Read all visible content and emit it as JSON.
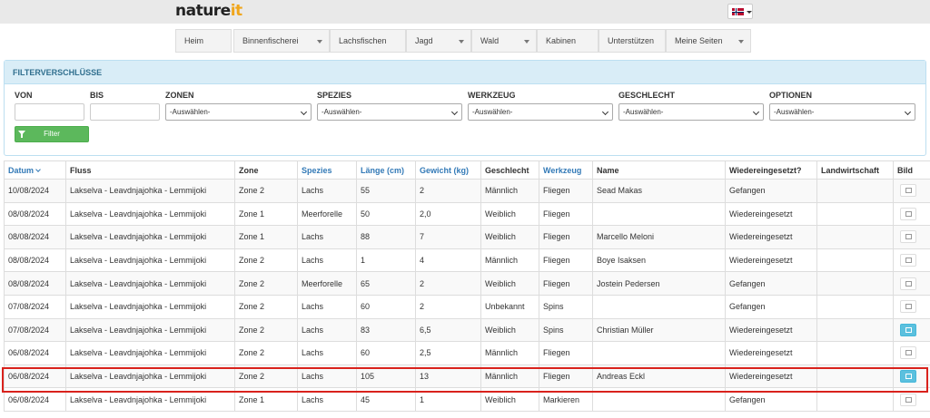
{
  "header": {
    "logo_part1": "nature",
    "logo_part2": "it"
  },
  "nav": [
    {
      "label": "Heim",
      "dropdown": false
    },
    {
      "label": "Binnenfischerei",
      "dropdown": true
    },
    {
      "label": "Lachsfischen",
      "dropdown": false
    },
    {
      "label": "Jagd",
      "dropdown": true
    },
    {
      "label": "Wald",
      "dropdown": true
    },
    {
      "label": "Kabinen",
      "dropdown": false
    },
    {
      "label": "Unterstützen",
      "dropdown": false
    },
    {
      "label": "Meine Seiten",
      "dropdown": true
    }
  ],
  "filter": {
    "title": "FILTERVERSCHLÜSSE",
    "labels": {
      "von": "VON",
      "bis": "BIS",
      "zonen": "ZONEN",
      "spezies": "SPEZIES",
      "werkzeug": "WERKZEUG",
      "geschlecht": "GESCHLECHT",
      "optionen": "OPTIONEN"
    },
    "select_placeholder": "-Auswählen-",
    "button_label": "Filter"
  },
  "table": {
    "headers": [
      "Datum",
      "Fluss",
      "Zone",
      "Spezies",
      "Länge (cm)",
      "Gewicht (kg)",
      "Geschlecht",
      "Werkzeug",
      "Name",
      "Wiedereingesetzt?",
      "Landwirtschaft",
      "Bild"
    ],
    "rows": [
      [
        "10/08/2024",
        "Lakselva - Leavdnjajohka - Lemmijoki",
        "Zone 2",
        "Lachs",
        "55",
        "2",
        "Männlich",
        "Fliegen",
        "Sead Makas",
        "Gefangen",
        "",
        ""
      ],
      [
        "08/08/2024",
        "Lakselva - Leavdnjajohka - Lemmijoki",
        "Zone 1",
        "Meerforelle",
        "50",
        "2,0",
        "Weiblich",
        "Fliegen",
        "",
        "Wiedereingesetzt",
        "",
        ""
      ],
      [
        "08/08/2024",
        "Lakselva - Leavdnjajohka - Lemmijoki",
        "Zone 1",
        "Lachs",
        "88",
        "7",
        "Weiblich",
        "Fliegen",
        "Marcello Meloni",
        "Wiedereingesetzt",
        "",
        ""
      ],
      [
        "08/08/2024",
        "Lakselva - Leavdnjajohka - Lemmijoki",
        "Zone 2",
        "Lachs",
        "1",
        "4",
        "Männlich",
        "Fliegen",
        "Boye Isaksen",
        "Wiedereingesetzt",
        "",
        ""
      ],
      [
        "08/08/2024",
        "Lakselva - Leavdnjajohka - Lemmijoki",
        "Zone 2",
        "Meerforelle",
        "65",
        "2",
        "Weiblich",
        "Fliegen",
        "Jostein Pedersen",
        "Gefangen",
        "",
        ""
      ],
      [
        "07/08/2024",
        "Lakselva - Leavdnjajohka - Lemmijoki",
        "Zone 2",
        "Lachs",
        "60",
        "2",
        "Unbekannt",
        "Spins",
        "",
        "Gefangen",
        "",
        ""
      ],
      [
        "07/08/2024",
        "Lakselva - Leavdnjajohka - Lemmijoki",
        "Zone 2",
        "Lachs",
        "83",
        "6,5",
        "Weiblich",
        "Spins",
        "Christian Müller",
        "Wiedereingesetzt",
        "",
        ""
      ],
      [
        "06/08/2024",
        "Lakselva - Leavdnjajohka - Lemmijoki",
        "Zone 2",
        "Lachs",
        "60",
        "2,5",
        "Männlich",
        "Fliegen",
        "",
        "Wiedereingesetzt",
        "",
        ""
      ],
      [
        "06/08/2024",
        "Lakselva - Leavdnjajohka - Lemmijoki",
        "Zone 2",
        "Lachs",
        "105",
        "13",
        "Männlich",
        "Fliegen",
        "Andreas Eckl",
        "Wiedereingesetzt",
        "",
        ""
      ],
      [
        "06/08/2024",
        "Lakselva - Leavdnjajohka - Lemmijoki",
        "Zone 1",
        "Lachs",
        "45",
        "1",
        "Weiblich",
        "Markieren",
        "",
        "Gefangen",
        "",
        ""
      ]
    ],
    "image_active": [
      false,
      false,
      false,
      false,
      false,
      false,
      true,
      false,
      true,
      false
    ],
    "highlighted_row": 8
  }
}
